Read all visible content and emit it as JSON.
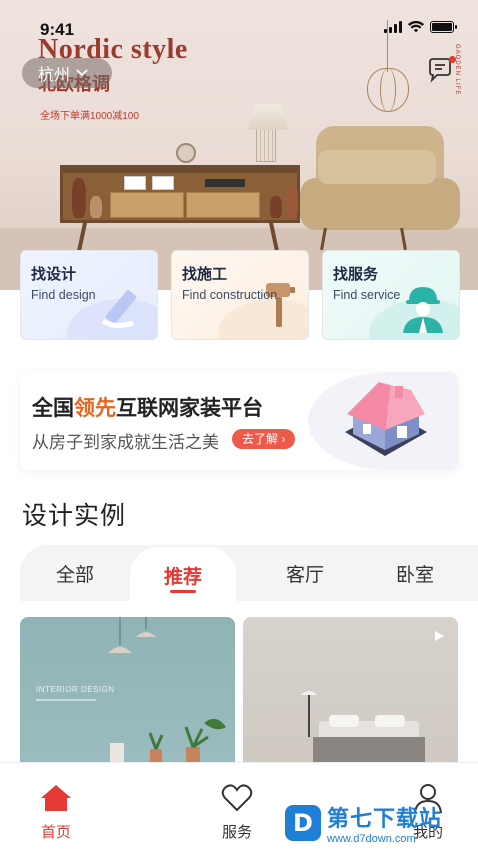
{
  "status_bar": {
    "time": "9:41"
  },
  "hero": {
    "title_en": "Nordic  style",
    "title_cn": "北欧格调",
    "promo": "全场下单满1000减100",
    "city": "杭州",
    "brand_vertical": "GAODEN LIFE"
  },
  "services": [
    {
      "title": "找设计",
      "subtitle": "Find design"
    },
    {
      "title": "找施工",
      "subtitle": "Find construction"
    },
    {
      "title": "找服务",
      "subtitle": "Find service"
    }
  ],
  "promo_banner": {
    "title_prefix": "全国",
    "title_highlight": "领先",
    "title_suffix": "互联网家装平台",
    "subtitle": "从房子到家成就生活之美",
    "button": "去了解 ›"
  },
  "section": {
    "title": "设计实例"
  },
  "tabs": [
    {
      "label": "全部"
    },
    {
      "label": "推荐"
    },
    {
      "label": "客厅"
    },
    {
      "label": "卧室"
    }
  ],
  "gallery": {
    "caption_1": "INTERIOR DESIGN"
  },
  "tabbar": [
    {
      "label": "首页"
    },
    {
      "label": "服务"
    },
    {
      "label": "我的"
    }
  ],
  "watermark": {
    "brand": "第七下载站",
    "url": "www.d7down.com"
  },
  "colors": {
    "accent": "#e53935",
    "highlight": "#e8641c",
    "hero_text": "#9d3a2e"
  }
}
